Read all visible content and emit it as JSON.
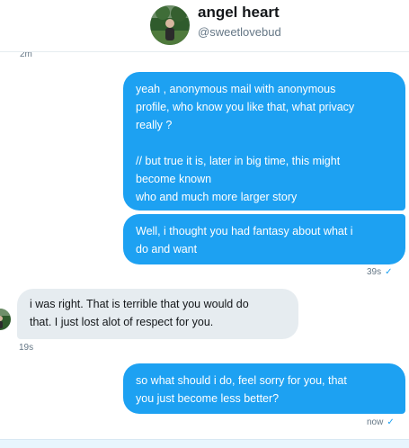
{
  "header": {
    "name": "angel heart",
    "handle": "@sweetlovebud"
  },
  "timestamps": {
    "first": "2m",
    "after_out_1": "39s",
    "after_in_1": "19s",
    "after_out_2": "now"
  },
  "messages": [
    {
      "direction": "outgoing",
      "lines": [
        "yeah , anonymous mail with anonymous",
        "profile, who know you like that, what privacy",
        "really ?",
        "",
        "// but true it is, later in big time, this might",
        "become known",
        "who and much more larger story"
      ]
    },
    {
      "direction": "outgoing",
      "lines": [
        "Well, i thought you had fantasy about what i",
        "do and want"
      ]
    },
    {
      "direction": "incoming",
      "lines": [
        "i was right.  That is terrible that you would do",
        "that.  I just lost alot of respect for you."
      ]
    },
    {
      "direction": "outgoing",
      "lines": [
        "so what should i do, feel sorry for you, that",
        "you just become less better?"
      ]
    }
  ],
  "icons": {
    "check": "✓"
  },
  "colors": {
    "outgoing_bubble": "#1da1f2",
    "incoming_bubble": "#e6ecf0",
    "text_secondary": "#657786",
    "check": "#1da1f2"
  }
}
